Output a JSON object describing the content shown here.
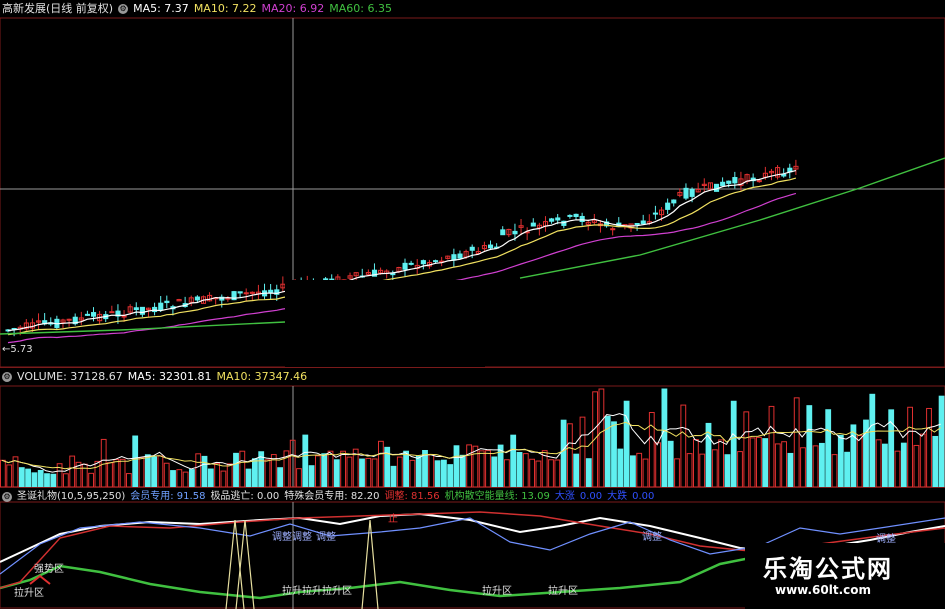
{
  "price_header": {
    "title": "高新发展(日线 前复权)",
    "ma5": "MA5: 7.37",
    "ma10": "MA10: 7.22",
    "ma20": "MA20: 6.92",
    "ma60": "MA60: 6.35",
    "low_label": "←5.73"
  },
  "volume_header": {
    "title": "VOLUME: 37128.67",
    "ma5": "MA5: 32301.81",
    "ma10": "MA10: 37347.46"
  },
  "indicator_header": {
    "title": "圣诞礼物(10,5,95,250)",
    "member": "会员专用: 91.58",
    "escape": "极品逃亡: 0.00",
    "special": "特殊会员专用: 82.20",
    "adjust": "调整: 81.56",
    "capital": "机构散空能量线: 13.09",
    "big_up": "大涨",
    "big_up_val": "0.00",
    "big_down": "大跌",
    "big_down_val": "0.00"
  },
  "indicator_labels": {
    "rise_zone": "拉升区",
    "strong_zone": "强势区",
    "adjust": "调整",
    "ladder": "调整调整",
    "stop": "止",
    "rise_combo": "拉升拉升拉升区"
  },
  "logo": {
    "name": "乐淘公式网",
    "url": "www.60lt.com"
  },
  "colors": {
    "up": "#e03030",
    "down": "#5ff0f0",
    "ma5": "#ffffff",
    "ma10": "#f0e060",
    "ma20": "#d040d0",
    "ma60": "#40c040",
    "frame": "#7a1a1a"
  }
}
